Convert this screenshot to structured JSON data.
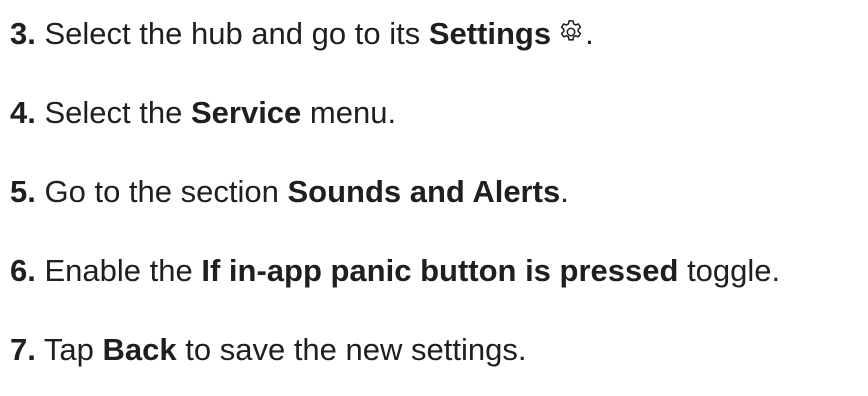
{
  "steps": [
    {
      "number": "3.",
      "parts": [
        "Select the hub and go to its ",
        "Settings",
        ""
      ],
      "icon": "gear-icon",
      "end": "."
    },
    {
      "number": "4.",
      "parts": [
        "Select the ",
        "Service",
        " menu."
      ]
    },
    {
      "number": "5.",
      "parts": [
        "Go to the section ",
        "Sounds and Alerts",
        "."
      ]
    },
    {
      "number": "6.",
      "parts": [
        "Enable the ",
        "If in-app panic button is pressed",
        " toggle."
      ]
    },
    {
      "number": "7.",
      "parts": [
        "Tap ",
        "Back",
        " to save the new settings."
      ]
    }
  ]
}
